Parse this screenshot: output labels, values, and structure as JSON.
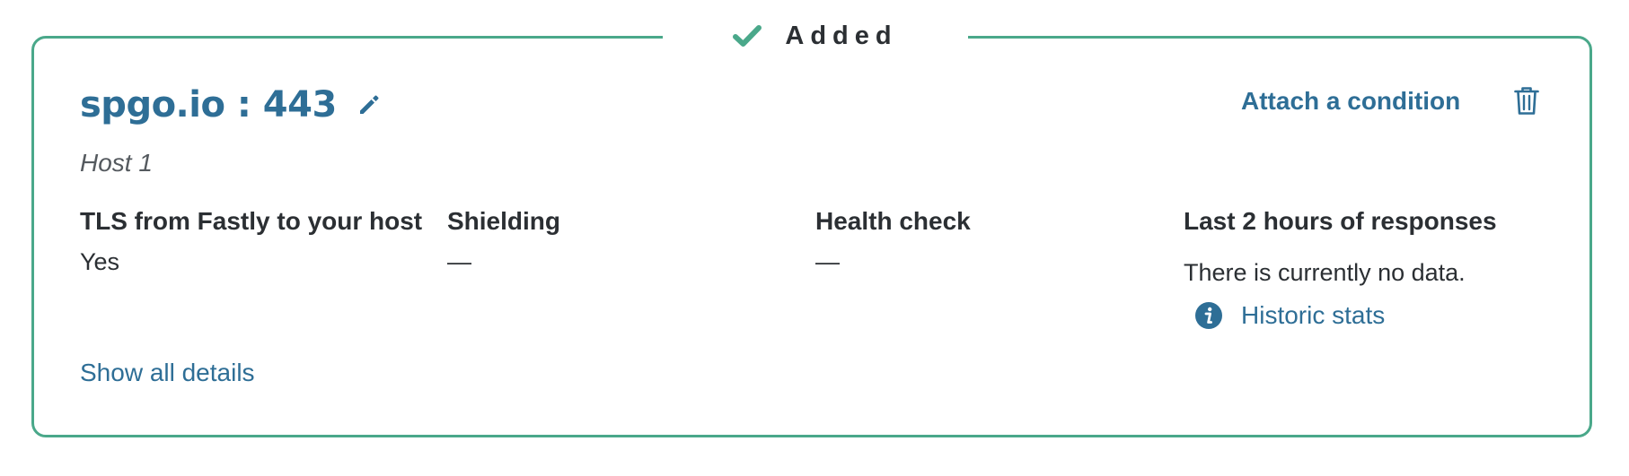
{
  "status": {
    "label": "Added",
    "icon": "check-icon",
    "color": "#4aa88a"
  },
  "host": {
    "name": "spgo.io : 443",
    "subtitle": "Host 1",
    "edit_icon": "pencil-icon"
  },
  "actions": {
    "attach_condition": "Attach a condition",
    "delete_icon": "trash-icon"
  },
  "details": {
    "tls": {
      "title": "TLS from Fastly to your host",
      "value": "Yes"
    },
    "shielding": {
      "title": "Shielding",
      "value": "—"
    },
    "health_check": {
      "title": "Health check",
      "value": "—"
    },
    "responses": {
      "title": "Last 2 hours of responses",
      "value": "There is currently no data.",
      "historic_link": "Historic stats",
      "historic_icon": "info-icon"
    }
  },
  "footer": {
    "show_details": "Show all details"
  },
  "colors": {
    "accent": "#2e6e96",
    "border": "#4aa88a",
    "text": "#2b2f33"
  }
}
